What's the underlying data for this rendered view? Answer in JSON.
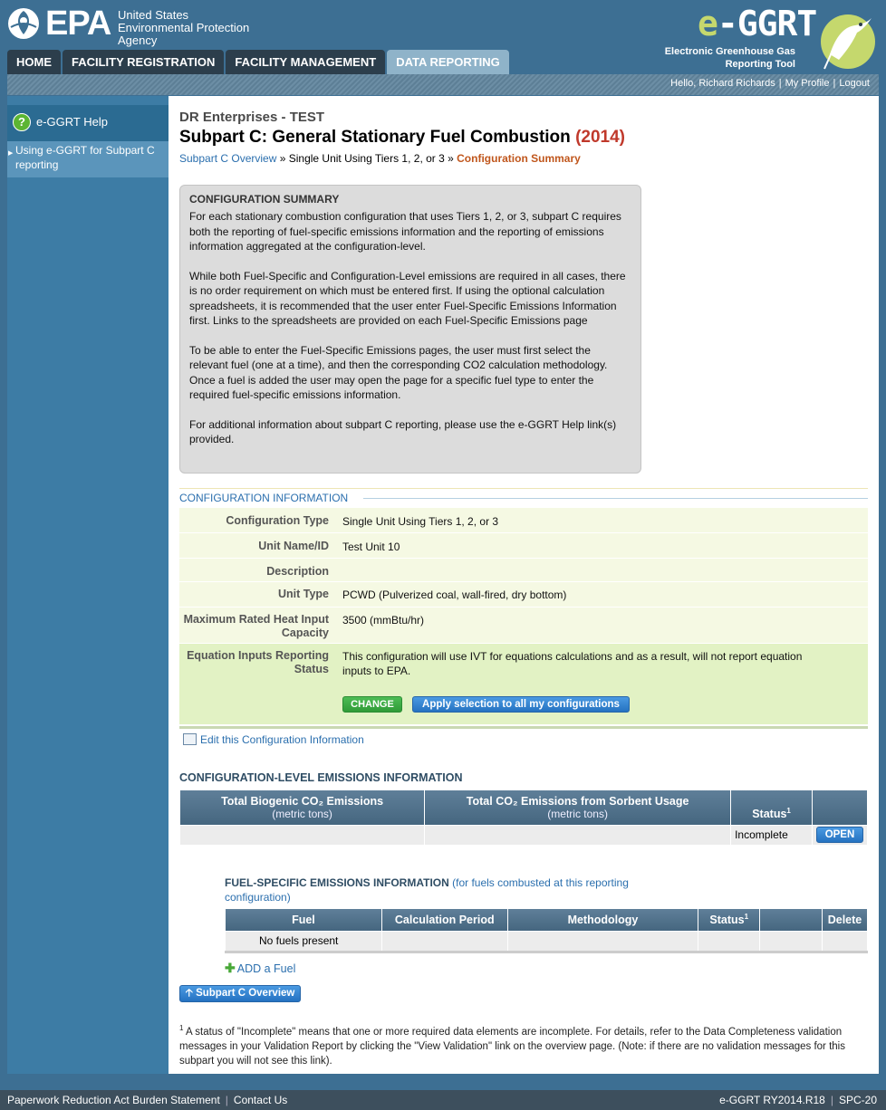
{
  "header": {
    "epa_logo_text": "EPA",
    "agency_lines": [
      "United States",
      "Environmental Protection",
      "Agency"
    ],
    "app_logo_title_e": "e",
    "app_logo_title_rest": "-GGRT",
    "app_logo_sub_lines": [
      "Electronic Greenhouse Gas",
      "Reporting Tool"
    ]
  },
  "nav": {
    "tabs": [
      {
        "label": "HOME"
      },
      {
        "label": "FACILITY REGISTRATION"
      },
      {
        "label": "FACILITY MANAGEMENT"
      },
      {
        "label": "DATA REPORTING"
      }
    ],
    "active": "DATA REPORTING"
  },
  "userbar": {
    "greeting": "Hello, Richard Richards",
    "profile": "My Profile",
    "logout": "Logout",
    "separator": "|"
  },
  "sidebar": {
    "help_icon": "?",
    "help_label": "e-GGRT Help",
    "help_link": "Using e-GGRT for Subpart C reporting"
  },
  "main": {
    "company": "DR Enterprises - TEST",
    "title": "Subpart C: General Stationary Fuel Combustion",
    "year": "(2014)",
    "breadcrumb": {
      "link": "Subpart C Overview",
      "sep1": " » ",
      "middle": "Single Unit Using Tiers 1, 2, or 3",
      "sep2": " » ",
      "current": "Configuration Summary"
    },
    "summary": {
      "heading": "CONFIGURATION SUMMARY",
      "paragraphs": [
        "For each stationary combustion configuration that uses Tiers 1, 2, or 3, subpart C requires both the reporting of fuel-specific emissions information and the reporting of emissions information aggregated at the configuration-level.",
        "While both Fuel-Specific and Configuration-Level emissions are required in all cases, there is no order requirement on which must be entered first. If using the optional calculation spreadsheets, it is recommended that the user enter Fuel-Specific Emissions Information first. Links to the spreadsheets are provided on each Fuel-Specific Emissions page",
        "To be able to enter the Fuel-Specific Emissions pages, the user must first select the relevant fuel (one at a time), and then the corresponding CO2 calculation methodology. Once a fuel is added the user may open the page for a specific fuel type to enter the required fuel-specific emissions information.",
        "For additional information about subpart C reporting, please use the e-GGRT Help link(s) provided."
      ]
    },
    "config_info": {
      "heading": "CONFIGURATION INFORMATION",
      "rows": [
        {
          "label": "Configuration Type",
          "value": "Single Unit Using Tiers 1, 2, or 3"
        },
        {
          "label": "Unit Name/ID",
          "value": "Test Unit 10"
        },
        {
          "label": "Description",
          "value": ""
        },
        {
          "label": "Unit Type",
          "value": "PCWD (Pulverized coal, wall-fired, dry bottom)"
        },
        {
          "label": "Maximum Rated Heat Input Capacity",
          "value": "3500 (mmBtu/hr)"
        },
        {
          "label": "Equation Inputs Reporting Status",
          "value": "This configuration will use IVT for equations calculations and as a result, will not report equation inputs to EPA."
        }
      ],
      "change_button": "CHANGE",
      "apply_button": "Apply selection to all my configurations",
      "edit_link": "Edit this Configuration Information"
    },
    "config_emissions": {
      "heading": "CONFIGURATION-LEVEL EMISSIONS INFORMATION",
      "col1": "Total Biogenic CO₂ Emissions",
      "col1_units": "(metric tons)",
      "col2": "Total CO₂ Emissions from Sorbent Usage",
      "col2_units": "(metric tons)",
      "col3": "Status",
      "col3_sup": "1",
      "row": {
        "biogenic": "",
        "sorbent": "",
        "status": "Incomplete",
        "open": "OPEN"
      }
    },
    "fuel_emissions": {
      "heading": "FUEL-SPECIFIC EMISSIONS INFORMATION",
      "note": " (for fuels combusted at this reporting configuration)",
      "columns": [
        "Fuel",
        "Calculation Period",
        "Methodology",
        "Status",
        "",
        "Delete"
      ],
      "status_sup": "1",
      "empty_text": "No fuels present",
      "add_fuel": "ADD a Fuel"
    },
    "overview_button": "Subpart C Overview",
    "footnote_sup": "1",
    "footnote": " A status of \"Incomplete\" means that one or more required data elements are incomplete. For details, refer to the Data Completeness validation messages in your Validation Report by clicking the \"View Validation\" link on the overview page. (Note: if there are no validation messages for this subpart you will not see this link)."
  },
  "footer": {
    "left1": "Paperwork Reduction Act Burden Statement",
    "left2": "Contact Us",
    "right1": "e-GGRT RY2014.R18",
    "right2": "SPC-20",
    "sep": "|"
  },
  "colors": {
    "brand_blue": "#3d6f93",
    "accent_red": "#c0392b",
    "link_blue": "#2b6fae",
    "change_green": "#2f9b37"
  }
}
